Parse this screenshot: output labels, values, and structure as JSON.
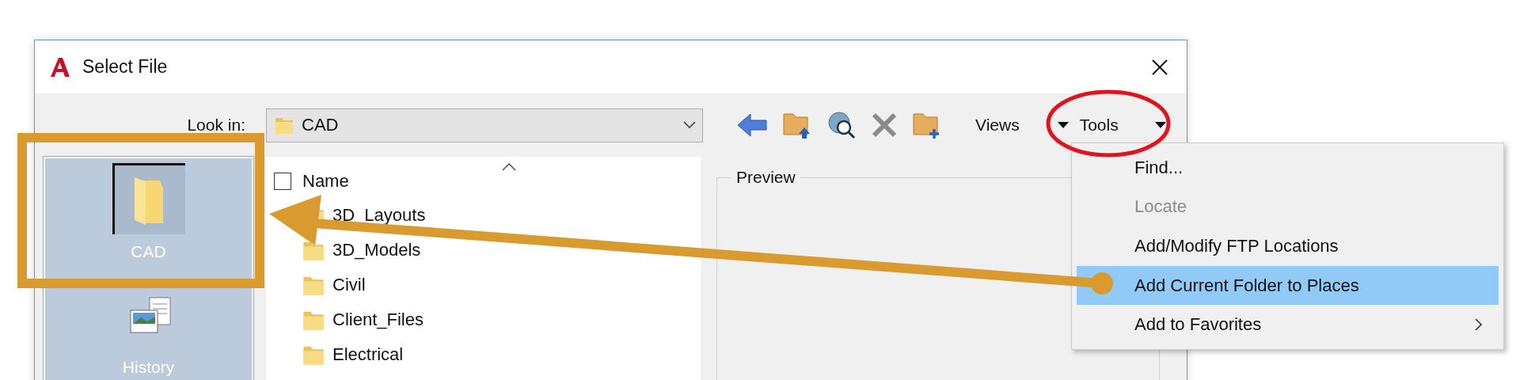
{
  "window": {
    "title": "Select File"
  },
  "toolbar": {
    "look_in_label": "Look in:",
    "look_in_value": "CAD",
    "views_label": "Views",
    "tools_label": "Tools"
  },
  "places": [
    {
      "label": "CAD",
      "kind": "folder",
      "selected": true
    },
    {
      "label": "History",
      "kind": "history",
      "selected": false
    }
  ],
  "file_list": {
    "column": "Name",
    "select_all_checked": false,
    "rows": [
      "3D_Layouts",
      "3D_Models",
      "Civil",
      "Client_Files",
      "Electrical"
    ]
  },
  "preview": {
    "label": "Preview"
  },
  "tools_menu": [
    {
      "label": "Find...",
      "disabled": false,
      "selected": false,
      "submenu": false
    },
    {
      "label": "Locate",
      "disabled": true,
      "selected": false,
      "submenu": false
    },
    {
      "label": "Add/Modify FTP Locations",
      "disabled": false,
      "selected": false,
      "submenu": false
    },
    {
      "label": "Add Current Folder to Places",
      "disabled": false,
      "selected": true,
      "submenu": false
    },
    {
      "label": "Add to Favorites",
      "disabled": false,
      "selected": false,
      "submenu": true
    }
  ]
}
